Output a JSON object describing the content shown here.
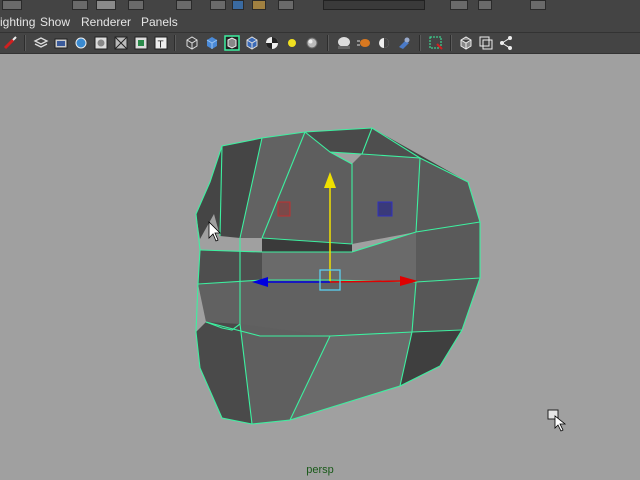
{
  "menus": [
    {
      "label": "ighting"
    },
    {
      "label": "Show"
    },
    {
      "label": "Renderer"
    },
    {
      "label": "Panels"
    }
  ],
  "viewport": {
    "camera_label": "persp"
  },
  "icons": {
    "toolbar": [
      "brush-icon",
      "select-camera-icon",
      "film-gate-icon",
      "camera-icon",
      "resolution-gate-icon",
      "grid-icon",
      "safe-action-icon",
      "field-chart-icon",
      "image-plane-icon",
      "wireframe-icon",
      "smooth-shade-icon",
      "wireframe-on-shaded-icon",
      "bounding-box-icon",
      "textured-icon",
      "use-lights-icon",
      "shadows-icon",
      "high-quality-icon",
      "motion-blur-icon",
      "depth-of-field-icon",
      "ambient-occlusion-icon",
      "isolate-select-icon",
      "x-ray-icon",
      "x-ray-joints-icon",
      "backface-culling-icon"
    ]
  },
  "colors": {
    "panel": "#444444",
    "viewport_bg": "#a0a0a0",
    "selection_wire": "#3df0a0",
    "mesh_face": "#5c5c5c",
    "axis_x": "#e00000",
    "axis_y": "#f0e000",
    "axis_z": "#0000e0",
    "camera_label": "#1a5a1a"
  }
}
